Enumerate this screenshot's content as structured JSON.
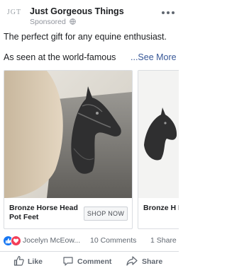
{
  "post": {
    "avatar_text": "JGT",
    "page_name": "Just Gorgeous Things",
    "sponsored": "Sponsored",
    "text_line1": "The perfect gift for any equine enthusiast.",
    "text_line2": "As seen at the world-famous",
    "see_more": "...See More"
  },
  "cards": [
    {
      "title": "Bronze Horse Head Pot Feet",
      "button": "SHOP NOW"
    },
    {
      "title": "Bronze H Head Pot"
    }
  ],
  "reactions": {
    "names": "Jocelyn McEow...",
    "comments": "10 Comments",
    "shares": "1 Share"
  },
  "actions": {
    "like": "Like",
    "comment": "Comment",
    "share": "Share"
  },
  "colors": {
    "link": "#385898",
    "like_blue": "#1877f2",
    "love_red": "#f33e58"
  },
  "icons": [
    "globe-icon",
    "more-icon",
    "like-reaction-icon",
    "love-reaction-icon",
    "thumbs-up-icon",
    "comment-icon",
    "share-icon"
  ]
}
